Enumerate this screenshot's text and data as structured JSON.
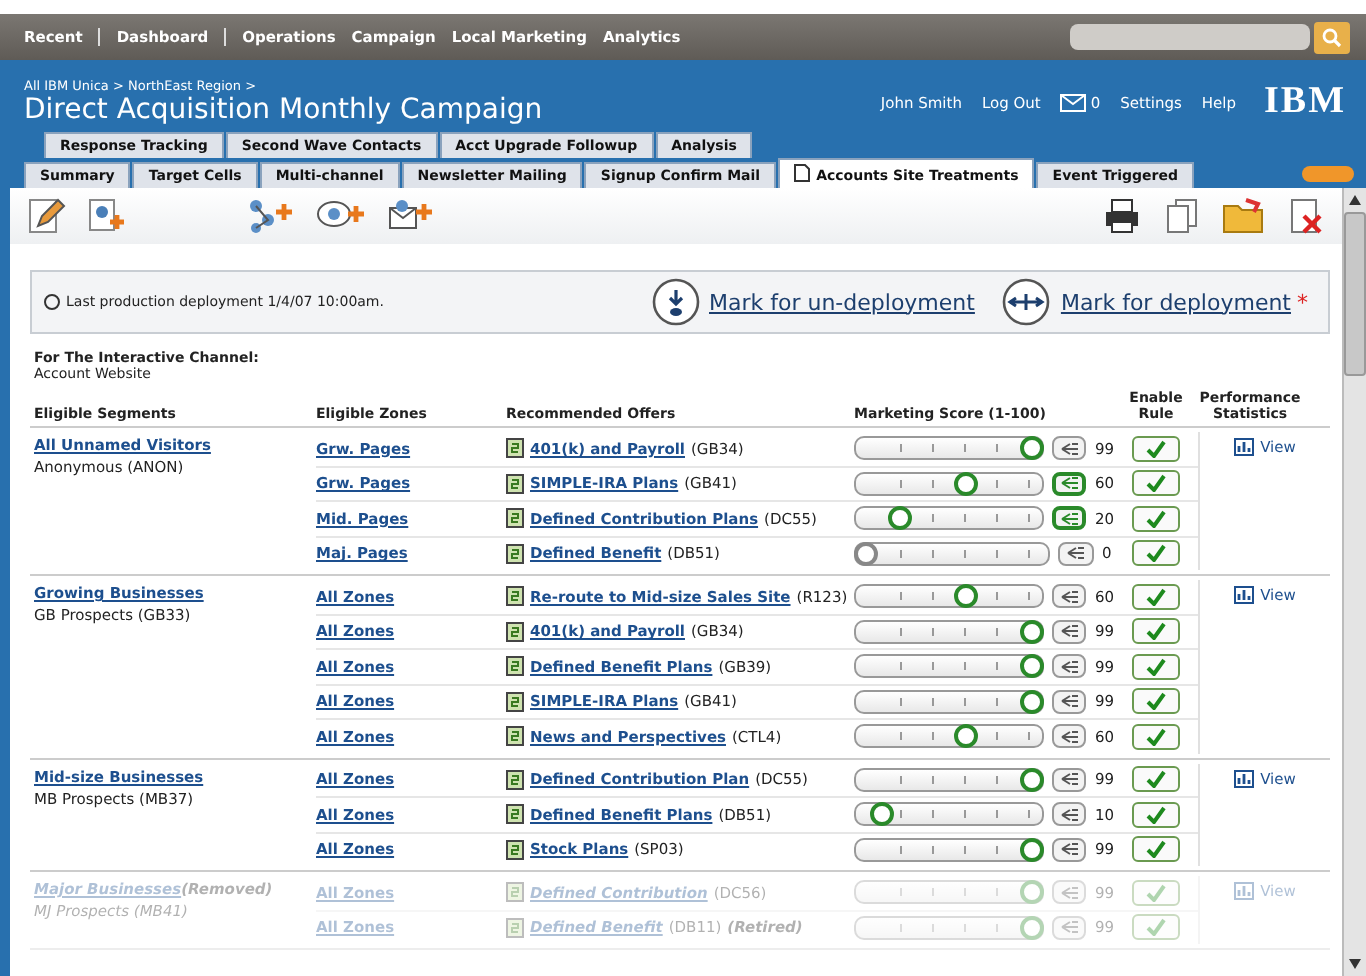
{
  "top_nav": {
    "items": [
      {
        "label": "Recent",
        "divider_after": true
      },
      {
        "label": "Dashboard",
        "divider_after": true
      },
      {
        "label": "Operations",
        "divider_after": false
      },
      {
        "label": "Campaign",
        "divider_after": false
      },
      {
        "label": "Local Marketing",
        "divider_after": false
      },
      {
        "label": "Analytics",
        "divider_after": false
      }
    ]
  },
  "header": {
    "breadcrumb": "All IBM Unica > NorthEast Region >",
    "title": "Direct Acquisition Monthly Campaign",
    "user": "John Smith",
    "logout": "Log Out",
    "messages": "0",
    "settings": "Settings",
    "help": "Help",
    "logo": "IBM"
  },
  "tabs_back": [
    {
      "label": "Response Tracking",
      "selected": false
    },
    {
      "label": "Second Wave Contacts",
      "selected": false
    },
    {
      "label": "Acct Upgrade Followup",
      "selected": false
    },
    {
      "label": "Analysis",
      "selected": false
    }
  ],
  "tabs_front": [
    {
      "label": "Summary",
      "selected": false
    },
    {
      "label": "Target Cells",
      "selected": false
    },
    {
      "label": "Multi-channel",
      "selected": false
    },
    {
      "label": "Newsletter Mailing",
      "selected": false
    },
    {
      "label": "Signup Confirm Mail",
      "selected": false
    },
    {
      "label": "Accounts Site Treatments",
      "selected": true
    },
    {
      "label": "Event Triggered",
      "selected": false
    }
  ],
  "deployment": {
    "status": "Last production deployment 1/4/07 10:00am.",
    "undeploy": "Mark for un-deployment",
    "deploy": "Mark for deployment",
    "required_mark": "*"
  },
  "channel": {
    "label": "For The Interactive Channel:",
    "name": "Account Website"
  },
  "table": {
    "columns": [
      "Eligible Segments",
      "Eligible Zones",
      "Recommended Offers",
      "Marketing Score (1-100)",
      "Enable Rule",
      "Performance Statistics"
    ],
    "groups": [
      {
        "segment": "All Unnamed Visitors",
        "code": "Anonymous (ANON)",
        "removed": false,
        "stats": "View",
        "rows": [
          {
            "zone": "Grw. Pages",
            "offer": "401(k) and Payroll",
            "offer_code": "(GB34)",
            "level": 0.99,
            "score": "99",
            "active": false,
            "enabled": true
          },
          {
            "zone": "Grw. Pages",
            "offer": "SIMPLE-IRA Plans",
            "offer_code": "(GB41)",
            "level": 0.6,
            "score": "60",
            "active": true,
            "enabled": true
          },
          {
            "zone": "Mid. Pages",
            "offer": "Defined Contribution Plans",
            "offer_code": "(DC55)",
            "level": 0.2,
            "score": "20",
            "active": true,
            "enabled": true
          },
          {
            "zone": "Maj. Pages",
            "offer": "Defined Benefit",
            "offer_code": "(DB51)",
            "level": 0,
            "score": "0",
            "active": false,
            "enabled": true
          }
        ]
      },
      {
        "segment": "Growing Businesses",
        "code": "GB Prospects (GB33)",
        "removed": false,
        "stats": "View",
        "rows": [
          {
            "zone": "All Zones",
            "offer": "Re-route to Mid-size Sales Site",
            "offer_code": "(R123)",
            "level": 0.6,
            "score": "60",
            "active": false,
            "enabled": true
          },
          {
            "zone": "All Zones",
            "offer": "401(k) and Payroll",
            "offer_code": "(GB34)",
            "level": 0.99,
            "score": "99",
            "active": false,
            "enabled": true
          },
          {
            "zone": "All Zones",
            "offer": "Defined Benefit Plans",
            "offer_code": "(GB39)",
            "level": 0.99,
            "score": "99",
            "active": false,
            "enabled": true
          },
          {
            "zone": "All Zones",
            "offer": "SIMPLE-IRA Plans",
            "offer_code": "(GB41)",
            "level": 0.99,
            "score": "99",
            "active": false,
            "enabled": true
          },
          {
            "zone": "All Zones",
            "offer": "News and Perspectives",
            "offer_code": "(CTL4)",
            "level": 0.6,
            "score": "60",
            "active": false,
            "enabled": true
          }
        ]
      },
      {
        "segment": "Mid-size Businesses",
        "code": "MB Prospects (MB37)",
        "removed": false,
        "stats": "View",
        "rows": [
          {
            "zone": "All Zones",
            "offer": "Defined Contribution Plan",
            "offer_code": "(DC55)",
            "level": 0.99,
            "score": "99",
            "active": false,
            "enabled": true
          },
          {
            "zone": "All Zones",
            "offer": "Defined Benefit Plans",
            "offer_code": "(DB51)",
            "level": 0.1,
            "score": "10",
            "active": false,
            "enabled": true
          },
          {
            "zone": "All Zones",
            "offer": "Stock Plans",
            "offer_code": "(SP03)",
            "level": 0.99,
            "score": "99",
            "active": false,
            "enabled": true
          }
        ]
      },
      {
        "segment": "Major Businesses",
        "segment_note": "(Removed)",
        "code": "MJ Prospects (MB41)",
        "removed": true,
        "stats": "View",
        "rows": [
          {
            "zone": "All Zones",
            "offer": "Defined Contribution",
            "offer_code": "(DC56)",
            "level": 0.99,
            "score": "99",
            "active": false,
            "enabled": true
          },
          {
            "zone": "All Zones",
            "offer": "Defined Benefit",
            "offer_code": "(DB11)",
            "note": "(Retired)",
            "level": 0.99,
            "score": "99",
            "active": false,
            "enabled": true
          }
        ]
      }
    ]
  }
}
